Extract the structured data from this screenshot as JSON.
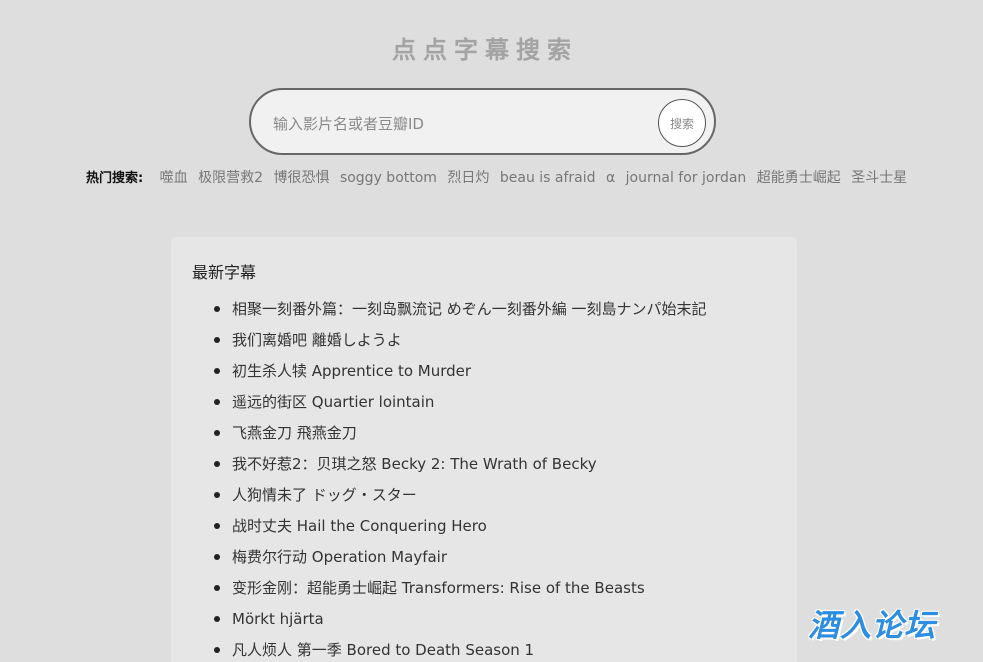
{
  "site": {
    "title": "点点字幕搜索"
  },
  "search": {
    "placeholder": "输入影片名或者豆瓣ID",
    "value": "",
    "button_label": "搜索"
  },
  "hot_searches": {
    "label": "热门搜索:",
    "items": [
      "噬血",
      "极限营救2",
      "博很恐惧",
      "soggy bottom",
      "烈日灼",
      "beau is afraid",
      "α",
      "journal for jordan",
      "超能勇士崛起",
      "圣斗士星"
    ]
  },
  "latest": {
    "title": "最新字幕",
    "items": [
      "相聚一刻番外篇：一刻岛飘流记 めぞん一刻番外編 一刻島ナンパ始末記",
      "我们离婚吧 離婚しようよ",
      "初生杀人犊 Apprentice to Murder",
      "遥远的街区 Quartier lointain",
      "飞燕金刀 飛燕金刀",
      "我不好惹2：贝琪之怒 Becky 2: The Wrath of Becky",
      "人狗情未了 ドッグ・スター",
      "战时丈夫 Hail the Conquering Hero",
      "梅费尔行动 Operation Mayfair",
      "变形金刚：超能勇士崛起 Transformers: Rise of the Beasts",
      "Mörkt hjärta",
      "凡人烦人 第一季 Bored to Death Season 1"
    ]
  },
  "watermark": {
    "text": "酒入论坛"
  },
  "colors": {
    "background": "#dedede",
    "panel": "#e6e6e6",
    "title": "#a3a3a3",
    "watermark": "#2d8de0"
  }
}
